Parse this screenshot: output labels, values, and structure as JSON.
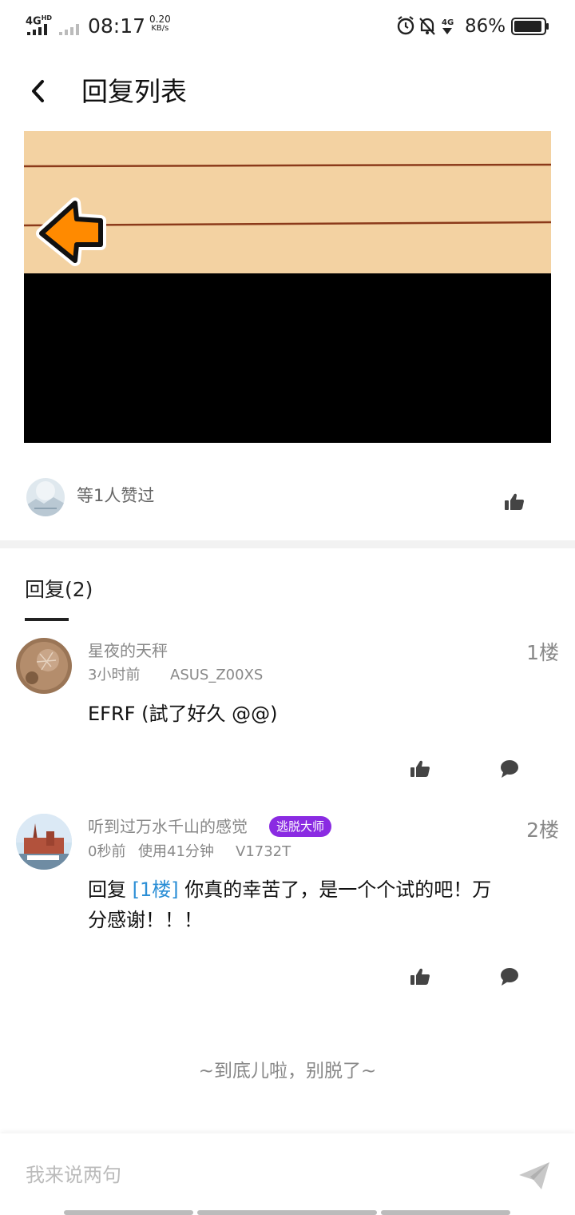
{
  "status_bar": {
    "network": "4G",
    "network_sup": "HD",
    "time": "08:17",
    "speed_value": "0.20",
    "speed_unit": "KB/s",
    "network2": "4G",
    "battery_percent": "86%"
  },
  "header": {
    "title": "回复列表",
    "back_icon": "chevron-left-icon"
  },
  "post": {
    "image_colors": {
      "paper": "#f3d2a2",
      "line": "#8b3a1a",
      "arrow": "#ff8a00",
      "dark": "#000000"
    }
  },
  "likes": {
    "text": "等1人赞过",
    "icon": "thumbs-up-icon"
  },
  "replies": {
    "title": "回复(2)",
    "items": [
      {
        "name": "星夜的天秤",
        "time": "3小时前",
        "device": "ASUS_Z00XS",
        "floor": "1楼",
        "content": "EFRF (試了好久 @@)"
      },
      {
        "name": "听到过万水千山的感觉",
        "badge": "逃脱大师",
        "time": "0秒前",
        "usage": "使用41分钟",
        "device": "V1732T",
        "floor": "2楼",
        "content_prefix": "回复",
        "content_ref": "[1楼]",
        "content_line1": "你真的幸苦了，是一个个试的吧！万",
        "content_line2": "分感谢！！！"
      }
    ]
  },
  "footer_note": "~到底儿啦，别脱了~",
  "input": {
    "placeholder": "我来说两句",
    "send_icon": "send-icon"
  },
  "accent": "#2c8fd6",
  "badge_color": "#8a2be2"
}
